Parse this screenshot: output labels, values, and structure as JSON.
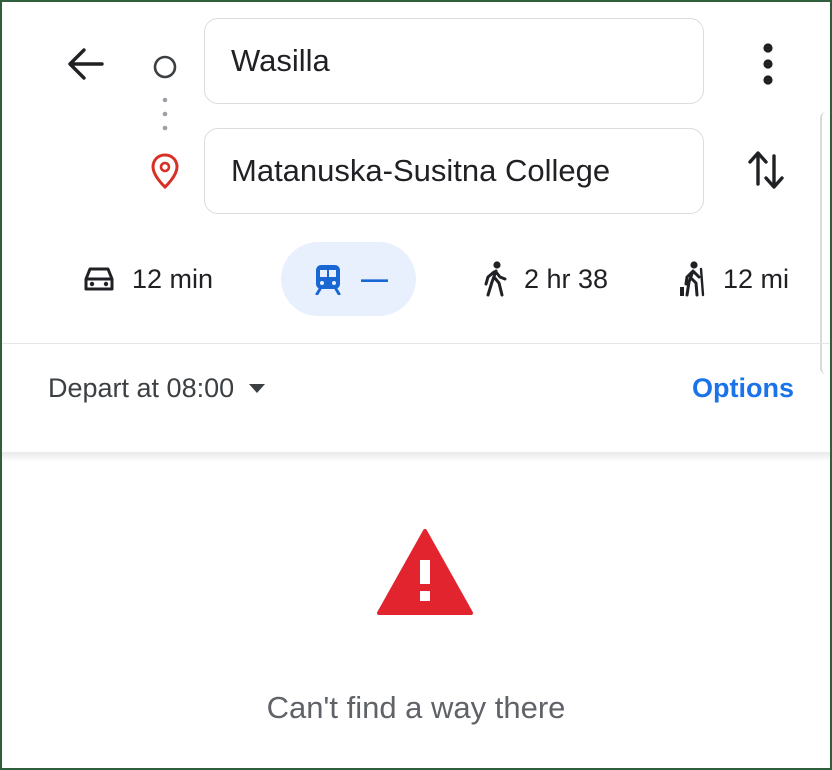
{
  "search": {
    "origin_value": "Wasilla",
    "destination_value": "Matanuska-Susitna College"
  },
  "travel_modes": [
    {
      "name": "drive",
      "icon": "car-icon",
      "label": "12 min"
    },
    {
      "name": "transit",
      "icon": "train-icon",
      "label": "—",
      "selected": true
    },
    {
      "name": "walk",
      "icon": "walk-icon",
      "label": "2 hr 38"
    },
    {
      "name": "ride",
      "icon": "person-with-cane-icon",
      "label": "12 mi"
    }
  ],
  "depart": {
    "label": "Depart at 08:00",
    "options_label": "Options"
  },
  "result": {
    "message": "Can't find a way there",
    "icon": "warning-icon"
  },
  "colors": {
    "accent": "#1a73e8",
    "selected_bg": "#e8f0fe",
    "warning": "#e2242f",
    "destination_pin": "#d93025"
  }
}
